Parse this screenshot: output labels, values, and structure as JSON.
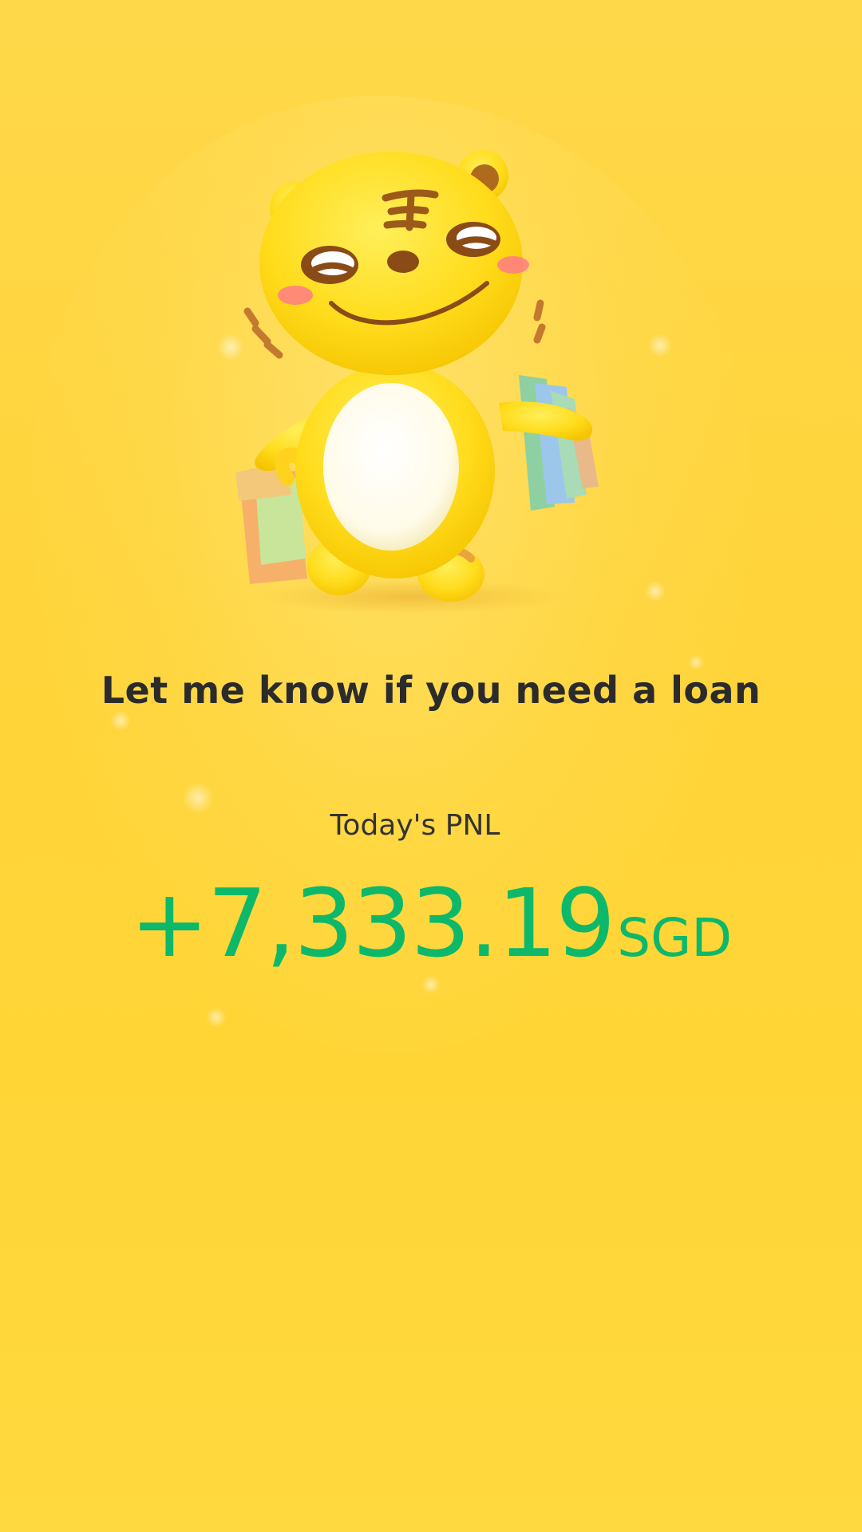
{
  "banner": {
    "mascot": "tiger-mascot-with-shopping-bags",
    "message": "Let me know if you need a loan"
  },
  "pnl": {
    "label": "Today's PNL",
    "value": "+7,333.19",
    "currency": "SGD",
    "value_color": "#0db86a"
  },
  "colors": {
    "background": "#ffd43a",
    "text_dark": "#2b2b2b"
  }
}
